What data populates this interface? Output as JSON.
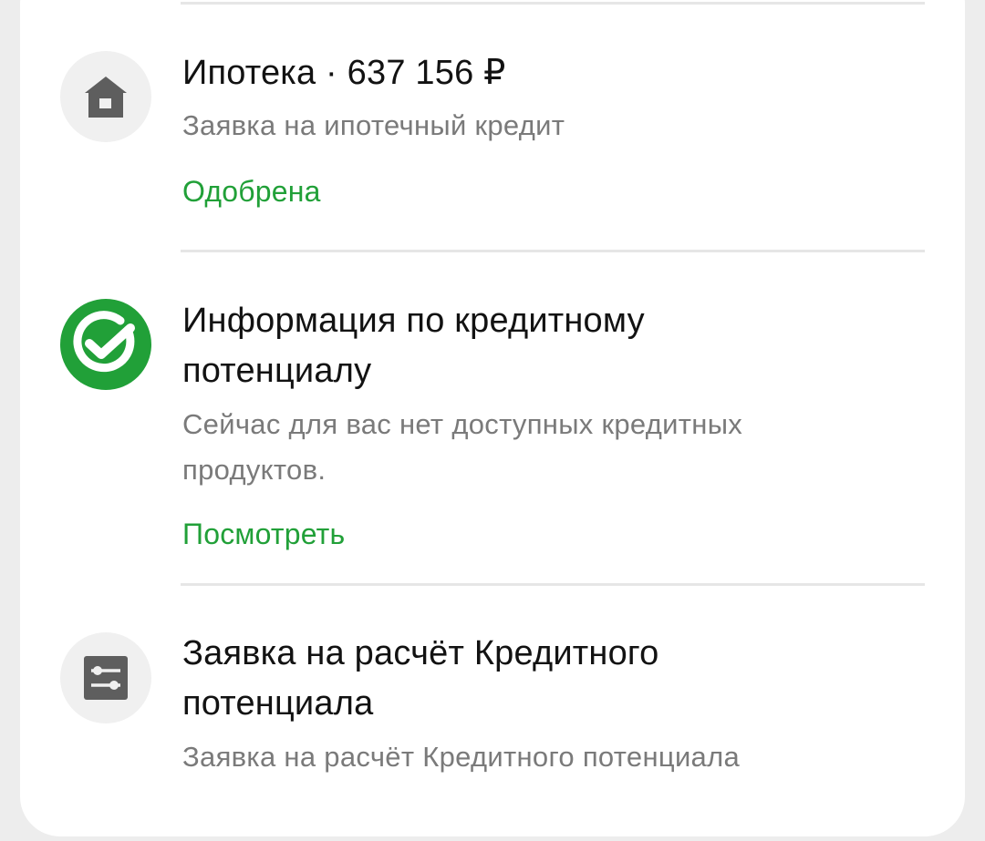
{
  "items": [
    {
      "title": "Ипотека · 637 156 ₽",
      "subtitle": "Заявка на ипотечный кредит",
      "status": "Одобрена",
      "icon": "house-icon",
      "status_color": "#21a038"
    },
    {
      "title_line1": "Информация по кредитному",
      "title_line2": "потенциалу",
      "subtitle_line1": "Сейчас для вас нет доступных кредитных",
      "subtitle_line2": "продуктов.",
      "action": "Посмотреть",
      "icon": "sber-checkmark-icon",
      "icon_color": "#21a038"
    },
    {
      "title_line1": "Заявка на расчёт Кредитного",
      "title_line2": "потенциала",
      "subtitle": "Заявка на расчёт Кредитного потенциала",
      "icon": "sliders-icon"
    }
  ],
  "colors": {
    "accent": "#21a038",
    "title": "#121212",
    "subtitle": "#7a7a7a",
    "icon_bg": "#f0f0f0",
    "icon_fg": "#5e5e5e"
  }
}
